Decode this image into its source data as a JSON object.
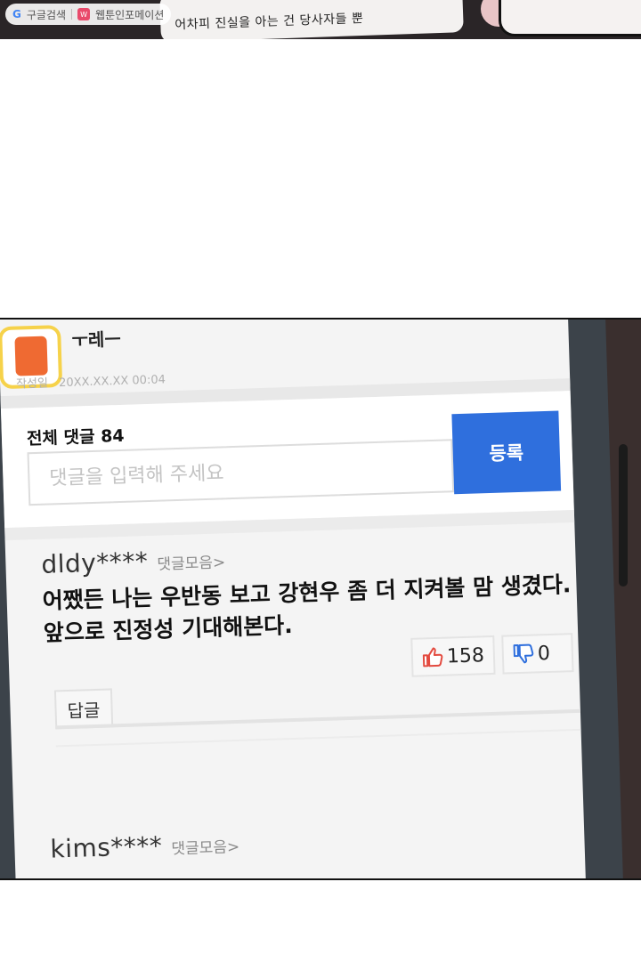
{
  "top_strip": {
    "watermark_left": "구글검색",
    "watermark_right": "웹툰인포메이션",
    "caption": "어차피 진실을 아는 건 당사자들 뿐"
  },
  "article": {
    "date_label": "작성일",
    "date_value": "20XX.XX.XX 00:04"
  },
  "comments_section": {
    "total_label": "전체 댓글 84",
    "input_placeholder": "댓글을 입력해 주세요",
    "register_label": "등록"
  },
  "comments": [
    {
      "user": "dldy****",
      "more_label": "댓글모음>",
      "body_line1": "어쨌든 나는 우반동 보고 강현우 좀 더 지켜볼 맘 생겼다.",
      "body_line2": "앞으로 진정성 기대해본다.",
      "likes": "158",
      "dislikes": "0",
      "reply_label": "답글"
    },
    {
      "user": "kims****",
      "more_label": "댓글모음>"
    }
  ],
  "colors": {
    "register_button": "#2f6fdd",
    "like_icon": "#e34a3f",
    "dislike_icon": "#2f6fdd",
    "logo_border": "#f6d24a",
    "logo_fill": "#ef6a32"
  }
}
